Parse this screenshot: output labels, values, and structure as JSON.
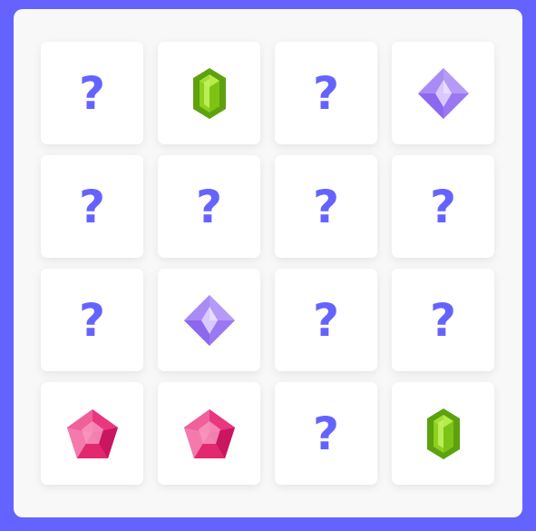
{
  "board": {
    "cards": [
      {
        "state": "hidden",
        "label": "?"
      },
      {
        "state": "revealed",
        "gem": "green-emerald-icon"
      },
      {
        "state": "hidden",
        "label": "?"
      },
      {
        "state": "revealed",
        "gem": "purple-diamond-icon"
      },
      {
        "state": "hidden",
        "label": "?"
      },
      {
        "state": "hidden",
        "label": "?"
      },
      {
        "state": "hidden",
        "label": "?"
      },
      {
        "state": "hidden",
        "label": "?"
      },
      {
        "state": "hidden",
        "label": "?"
      },
      {
        "state": "revealed",
        "gem": "purple-diamond-icon"
      },
      {
        "state": "hidden",
        "label": "?"
      },
      {
        "state": "hidden",
        "label": "?"
      },
      {
        "state": "revealed",
        "gem": "pink-pentagon-gem-icon"
      },
      {
        "state": "revealed",
        "gem": "pink-pentagon-gem-icon"
      },
      {
        "state": "hidden",
        "label": "?"
      },
      {
        "state": "revealed",
        "gem": "green-emerald-icon"
      }
    ]
  },
  "colors": {
    "background": "#6563ff",
    "board": "#f8f8f8",
    "card": "#ffffff",
    "question_mark": "#6563ff"
  }
}
